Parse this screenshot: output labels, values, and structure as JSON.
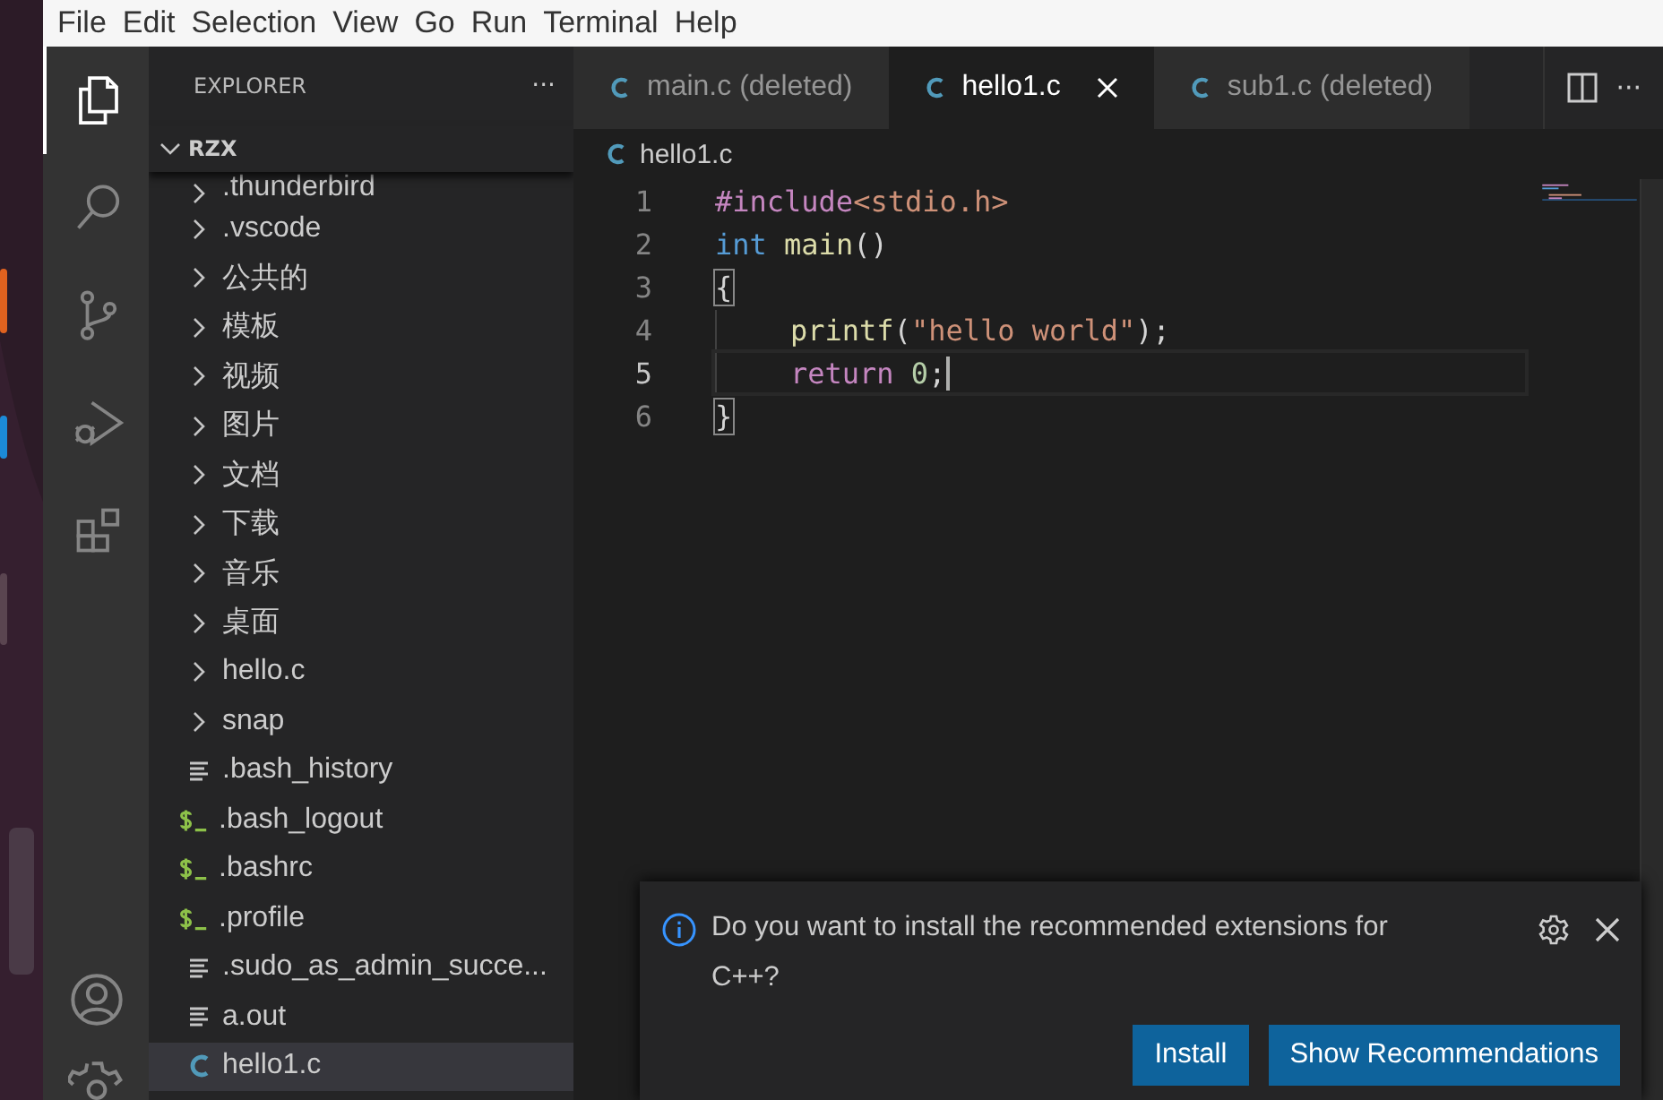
{
  "menu_bar": [
    "File",
    "Edit",
    "Selection",
    "View",
    "Go",
    "Run",
    "Terminal",
    "Help"
  ],
  "activity_bar": [
    {
      "kind": "explorer",
      "selected": true
    },
    {
      "kind": "search",
      "selected": false
    },
    {
      "kind": "source-control",
      "selected": false
    },
    {
      "kind": "run-debug",
      "selected": false
    },
    {
      "kind": "extensions",
      "selected": false
    }
  ],
  "activity_bar_bottom": [
    {
      "kind": "account"
    },
    {
      "kind": "settings"
    }
  ],
  "sidebar": {
    "title": "EXPLORER",
    "more": "···",
    "root": {
      "label": "RZX",
      "expanded": true,
      "children": [
        {
          "label": ".thunderbird",
          "kind": "folder",
          "selected": false
        },
        {
          "label": ".vscode",
          "kind": "folder",
          "selected": false
        },
        {
          "label": "公共的",
          "kind": "folder",
          "selected": false
        },
        {
          "label": "模板",
          "kind": "folder",
          "selected": false
        },
        {
          "label": "视频",
          "kind": "folder",
          "selected": false
        },
        {
          "label": "图片",
          "kind": "folder",
          "selected": false
        },
        {
          "label": "文档",
          "kind": "folder",
          "selected": false
        },
        {
          "label": "下载",
          "kind": "folder",
          "selected": false
        },
        {
          "label": "音乐",
          "kind": "folder",
          "selected": false
        },
        {
          "label": "桌面",
          "kind": "folder",
          "selected": false
        },
        {
          "label": "hello.c",
          "kind": "folder",
          "selected": false
        },
        {
          "label": "snap",
          "kind": "folder",
          "selected": false
        },
        {
          "label": ".bash_history",
          "kind": "text",
          "selected": false
        },
        {
          "label": ".bash_logout",
          "kind": "shell",
          "selected": false
        },
        {
          "label": ".bashrc",
          "kind": "shell",
          "selected": false
        },
        {
          "label": ".profile",
          "kind": "shell",
          "selected": false
        },
        {
          "label": ".sudo_as_admin_succe...",
          "kind": "text",
          "selected": false
        },
        {
          "label": "a.out",
          "kind": "text",
          "selected": false
        },
        {
          "label": "hello1.c",
          "kind": "c",
          "selected": true
        }
      ]
    }
  },
  "tabs": [
    {
      "label": "main.c (deleted)",
      "selected": false
    },
    {
      "label": "hello1.c",
      "selected": true
    },
    {
      "label": "sub1.c (deleted)",
      "selected": false
    }
  ],
  "tab_actions": {
    "more": "···"
  },
  "breadcrumb": "hello1.c",
  "code": [
    {
      "number": "1",
      "current": false,
      "indent": false,
      "tokens": [
        {
          "kind": "directive",
          "text": "#include"
        },
        {
          "kind": "string",
          "text": "<stdio.h>"
        }
      ]
    },
    {
      "number": "2",
      "current": false,
      "indent": false,
      "tokens": [
        {
          "kind": "keyword",
          "text": "int"
        },
        {
          "kind": "function",
          "text": " main"
        },
        {
          "kind": "plain",
          "text": "()"
        }
      ]
    },
    {
      "number": "3",
      "current": false,
      "indent": false,
      "tokens": [
        {
          "kind": "bracket",
          "text": "{"
        }
      ]
    },
    {
      "number": "4",
      "current": false,
      "indent": true,
      "tokens": [
        {
          "kind": "function",
          "text": "printf"
        },
        {
          "kind": "plain",
          "text": "("
        },
        {
          "kind": "string",
          "text": "\"hello world\""
        },
        {
          "kind": "plain",
          "text": ");"
        }
      ]
    },
    {
      "number": "5",
      "current": true,
      "indent": true,
      "tokens": [
        {
          "kind": "control",
          "text": "return"
        },
        {
          "kind": "number",
          "text": " 0"
        },
        {
          "kind": "plain",
          "text": ";"
        }
      ]
    },
    {
      "number": "6",
      "current": false,
      "indent": false,
      "tokens": [
        {
          "kind": "bracket",
          "text": "}"
        }
      ]
    }
  ],
  "notification": {
    "message": "Do you want to install the recommended extensions for C++?",
    "buttons": [
      "Install",
      "Show Recommendations"
    ]
  }
}
